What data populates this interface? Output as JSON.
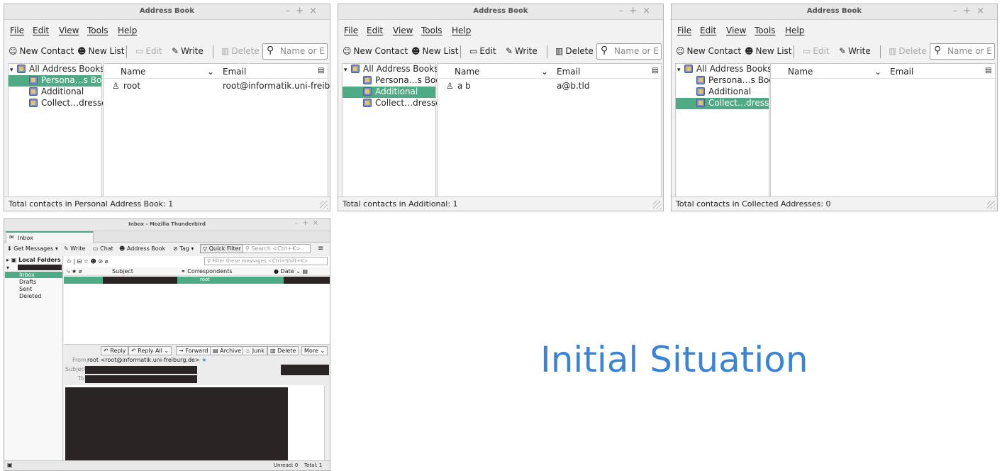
{
  "address_books": [
    {
      "title": "Address Book",
      "menu": [
        "File",
        "Edit",
        "View",
        "Tools",
        "Help"
      ],
      "toolbar": {
        "new_contact": "New Contact",
        "new_list": "New List",
        "edit": "Edit",
        "write": "Write",
        "delete": "Delete",
        "search_placeholder": "Name or E"
      },
      "edit_enabled": false,
      "delete_enabled": false,
      "tree": {
        "root": "All Address Books",
        "items": [
          "Persona…s Book",
          "Additional",
          "Collect…dresses"
        ],
        "selected": 0
      },
      "columns": {
        "name": "Name",
        "email": "Email"
      },
      "contacts": [
        {
          "name": "root",
          "email": "root@informatik.uni-freiburg.de"
        }
      ],
      "status": "Total contacts in Personal Address Book: 1"
    },
    {
      "title": "Address Book",
      "menu": [
        "File",
        "Edit",
        "View",
        "Tools",
        "Help"
      ],
      "toolbar": {
        "new_contact": "New Contact",
        "new_list": "New List",
        "edit": "Edit",
        "write": "Write",
        "delete": "Delete",
        "search_placeholder": "Name or E"
      },
      "edit_enabled": true,
      "delete_enabled": true,
      "tree": {
        "root": "All Address Books",
        "items": [
          "Persona…s Book",
          "Additional",
          "Collect…dresses"
        ],
        "selected": 1
      },
      "columns": {
        "name": "Name",
        "email": "Email"
      },
      "contacts": [
        {
          "name": "a b",
          "email": "a@b.tld"
        }
      ],
      "status": "Total contacts in Additional: 1"
    },
    {
      "title": "Address Book",
      "menu": [
        "File",
        "Edit",
        "View",
        "Tools",
        "Help"
      ],
      "toolbar": {
        "new_contact": "New Contact",
        "new_list": "New List",
        "edit": "Edit",
        "write": "Write",
        "delete": "Delete",
        "search_placeholder": "Name or E"
      },
      "edit_enabled": false,
      "delete_enabled": false,
      "tree": {
        "root": "All Address Books",
        "items": [
          "Persona…s Book",
          "Additional",
          "Collect…dresses"
        ],
        "selected": 2
      },
      "columns": {
        "name": "Name",
        "email": "Email"
      },
      "contacts": [],
      "status": "Total contacts in Collected Addresses: 0"
    }
  ],
  "thunderbird": {
    "title": "Inbox - Mozilla Thunderbird",
    "tab": "Inbox",
    "toolbar": {
      "get_messages": "Get Messages",
      "write": "Write",
      "chat": "Chat",
      "address_book": "Address Book",
      "tag": "Tag",
      "quick_filter": "Quick Filter",
      "search_placeholder": "Search <Ctrl+K>"
    },
    "filter_placeholder": "Filter these messages <Ctrl+Shift+K>",
    "folders": {
      "account": "Local Folders",
      "items": [
        "Inbox",
        "Drafts",
        "Sent",
        "Deleted"
      ],
      "selected": "Inbox"
    },
    "columns": {
      "subject": "Subject",
      "correspondents": "Correspondents",
      "date": "Date"
    },
    "message_row": {
      "correspondent": "root"
    },
    "actions": {
      "reply": "Reply",
      "reply_all": "Reply All",
      "forward": "Forward",
      "archive": "Archive",
      "junk": "Junk",
      "delete": "Delete",
      "more": "More"
    },
    "header": {
      "from_label": "From",
      "from_value": "root <root@informatik.uni-freiburg.de>",
      "subject_label": "Subject",
      "to_label": "To"
    },
    "status": {
      "unread": "Unread: 0",
      "total": "Total: 1"
    }
  },
  "caption": "Initial Situation",
  "colors": {
    "selection": "#4eab86",
    "caption": "#3a84d8",
    "redaction": "#2b2424"
  }
}
